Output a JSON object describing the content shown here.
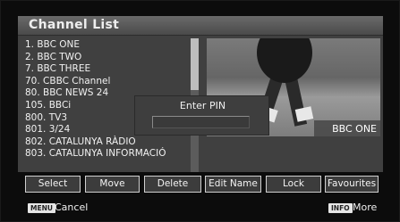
{
  "header": {
    "title": "Channel List"
  },
  "channels": [
    "1. BBC ONE",
    "2. BBC TWO",
    "7. BBC THREE",
    "70. CBBC Channel",
    "80. BBC NEWS 24",
    "105. BBCi",
    "800. TV3",
    "801. 3/24",
    "802. CATALUNYA RÀDIO",
    "803. CATALUNYA INFORMACIÓ"
  ],
  "preview": {
    "channel_name": "BBC ONE"
  },
  "pin_dialog": {
    "label": "Enter PIN",
    "value": ""
  },
  "buttons": {
    "select": "Select",
    "move": "Move",
    "delete": "Delete",
    "edit_name": "Edit Name",
    "lock": "Lock",
    "favourites": "Favourites"
  },
  "footer": {
    "menu_key": "MENU",
    "menu_text": "Cancel",
    "info_key": "INFO",
    "info_text": "More"
  }
}
